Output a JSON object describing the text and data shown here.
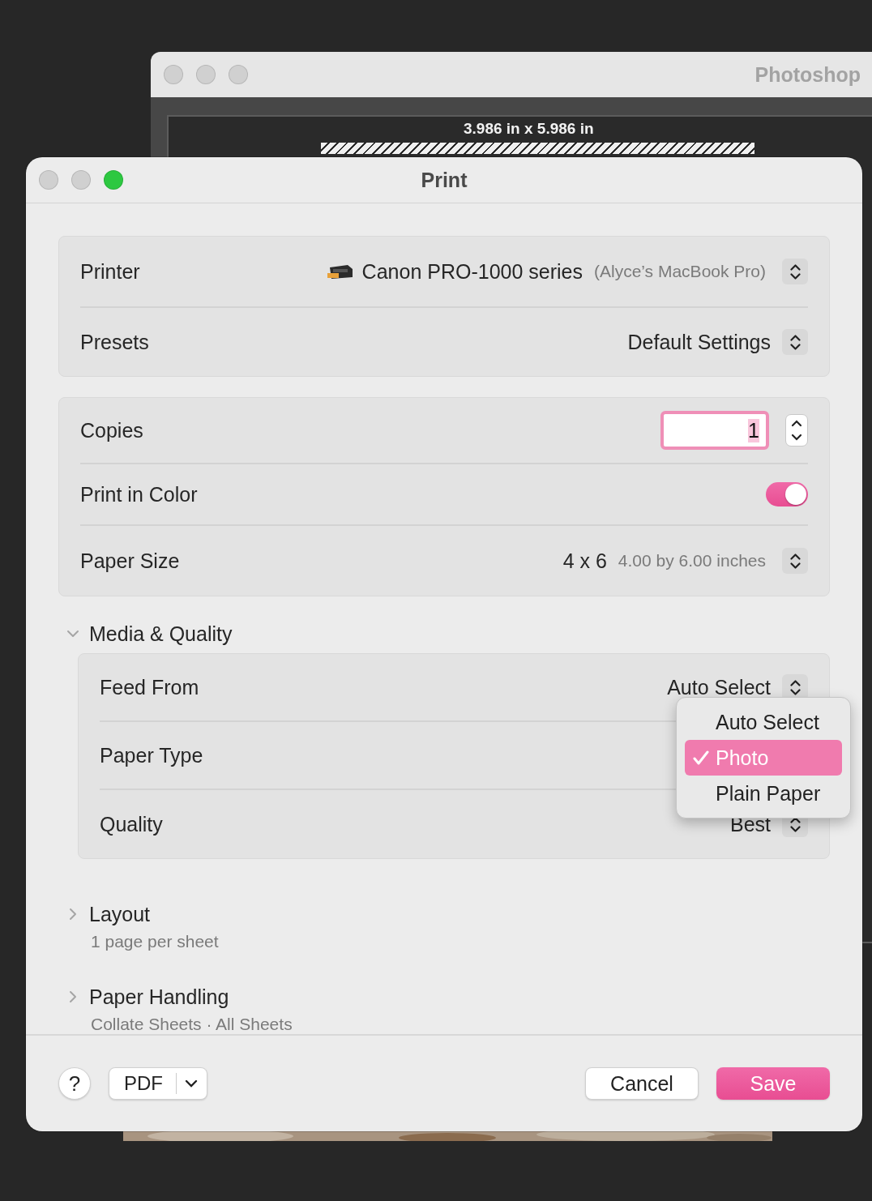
{
  "background_window": {
    "title": "Photoshop",
    "document_size": "3.986 in x 5.986 in"
  },
  "dialog": {
    "title": "Print"
  },
  "printer_card": [
    {
      "kind": "printer",
      "label": "Printer",
      "value": "Canon PRO-1000 series",
      "detail": "(Alyce’s MacBook Pro)"
    },
    {
      "kind": "popup",
      "label": "Presets",
      "value": "Default Settings"
    }
  ],
  "options_card": [
    {
      "kind": "stepper",
      "label": "Copies",
      "value": "1"
    },
    {
      "kind": "toggle",
      "label": "Print in Color",
      "on": true
    },
    {
      "kind": "popup",
      "label": "Paper Size",
      "value": "4 x 6",
      "detail": "4.00 by 6.00 inches"
    }
  ],
  "sections": [
    {
      "title": "Media & Quality",
      "expanded": true,
      "rows": [
        {
          "kind": "popup",
          "label": "Feed From",
          "value": "Auto Select"
        },
        {
          "kind": "covered",
          "label": "Paper Type"
        },
        {
          "kind": "popup",
          "label": "Quality",
          "value": "Best"
        }
      ]
    },
    {
      "title": "Layout",
      "expanded": false,
      "summary": "1 page per sheet"
    },
    {
      "title": "Paper Handling",
      "expanded": false,
      "summary": "Collate Sheets · All Sheets"
    }
  ],
  "paper_type_menu": [
    {
      "label": "Auto Select",
      "selected": false
    },
    {
      "label": "Photo",
      "selected": true
    },
    {
      "label": "Plain Paper",
      "selected": false
    }
  ],
  "footer": {
    "help": "?",
    "pdf": "PDF",
    "buttons": [
      {
        "label": "Cancel",
        "kind": "secondary"
      },
      {
        "label": "Save",
        "kind": "primary"
      }
    ]
  }
}
